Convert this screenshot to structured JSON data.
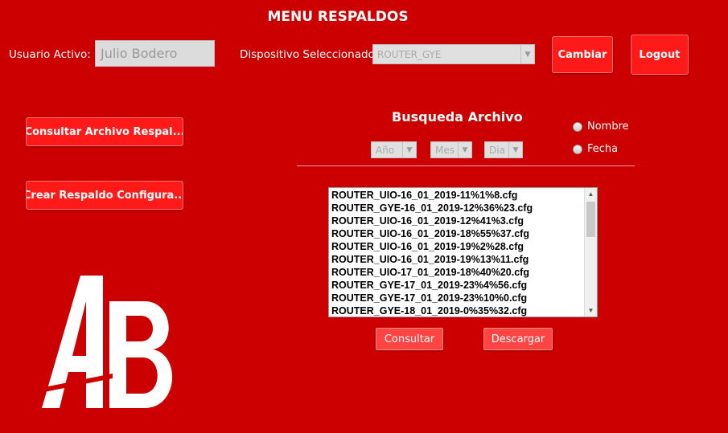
{
  "title": "MENU RESPALDOS",
  "user": {
    "label": "Usuario Activo:",
    "value": "Julio Bodero"
  },
  "device": {
    "label": "Dispositivo Seleccionado",
    "selected": "ROUTER_GYE"
  },
  "buttons": {
    "change": "Cambiar",
    "logout": "Logout",
    "consult_backup": "Consultar Archivo Respal...",
    "create_backup": "Crear Respaldo Configura...",
    "consult": "Consultar",
    "download": "Descargar"
  },
  "search": {
    "title": "Busqueda Archivo",
    "year": "Año",
    "month": "Mes",
    "day": "Dia",
    "radio_name": "Nombre",
    "radio_date": "Fecha"
  },
  "files": [
    "ROUTER_UIO-16_01_2019-11%1%8.cfg",
    "ROUTER_GYE-16_01_2019-12%36%23.cfg",
    "ROUTER_UIO-16_01_2019-12%41%3.cfg",
    "ROUTER_UIO-16_01_2019-18%55%37.cfg",
    "ROUTER_UIO-16_01_2019-19%2%28.cfg",
    "ROUTER_UIO-16_01_2019-19%13%11.cfg",
    "ROUTER_UIO-17_01_2019-18%40%20.cfg",
    "ROUTER_GYE-17_01_2019-23%4%56.cfg",
    "ROUTER_GYE-17_01_2019-23%10%0.cfg",
    "ROUTER_GYE-18_01_2019-0%35%32.cfg"
  ],
  "logo": {
    "text": "AB",
    "color": "#ffffff"
  },
  "colors": {
    "background": "#cc0000",
    "button": "#ff1a1a",
    "field": "#dcdcdc"
  }
}
